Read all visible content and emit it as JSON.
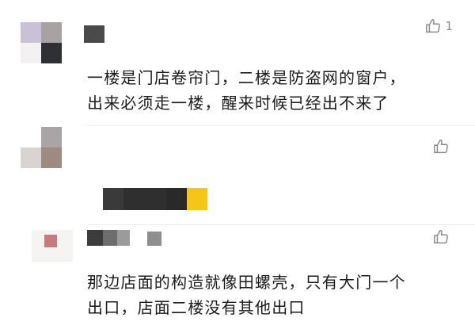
{
  "comments": [
    {
      "text": "一楼是门店卷帘门，二楼是防盗网的窗户，\n出来必须走一楼，醒来时候已经出不来了",
      "likes": "1",
      "like_icon": "thumbs-up-icon",
      "avatar": "pixelated-avatar",
      "username": "pixelated-username"
    },
    {
      "text": "",
      "likes": "",
      "like_icon": "thumbs-up-icon",
      "avatar": "pixelated-avatar",
      "username": "pixelated-username"
    },
    {
      "text": "那边店面的构造就像田螺壳，只有大门一个\n出口，店面二楼没有其他出口",
      "likes": "",
      "like_icon": "thumbs-up-icon",
      "avatar": "pixelated-avatar",
      "username": "pixelated-username"
    }
  ],
  "colors": {
    "icon_gray": "#8a8a8a",
    "badge_yellow": "#f5c518",
    "divider": "#ececec"
  }
}
